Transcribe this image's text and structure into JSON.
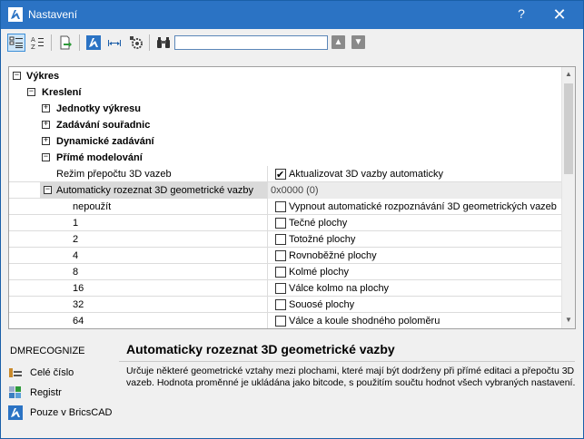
{
  "window": {
    "title": "Nastavení",
    "help": "?",
    "close": "✕"
  },
  "toolbar": {
    "search_value": "",
    "up_label": "▲",
    "down_label": "▼"
  },
  "tree": {
    "cat_vykres": "Výkres",
    "cat_kresleni": "Kreslení",
    "cat_jednotky": "Jednotky výkresu",
    "cat_zadavani": "Zadávání souřadnic",
    "cat_dynamicke": "Dynamické zadávání",
    "cat_prime": "Přímé modelování",
    "prop_rezim": "Režim přepočtu 3D vazeb",
    "prop_rezim_value": "Aktualizovat 3D vazby automaticky",
    "prop_auto": "Automaticky rozeznat 3D geometrické vazby",
    "prop_auto_value": "0x0000 (0)",
    "options": [
      {
        "num": "nepoužít",
        "label": "Vypnout automatické rozpoznávání 3D geometrických vazeb"
      },
      {
        "num": "1",
        "label": "Tečné plochy"
      },
      {
        "num": "2",
        "label": "Totožné plochy"
      },
      {
        "num": "4",
        "label": "Rovnoběžné plochy"
      },
      {
        "num": "8",
        "label": "Kolmé plochy"
      },
      {
        "num": "16",
        "label": "Válce kolmo na plochy"
      },
      {
        "num": "32",
        "label": "Souosé plochy"
      },
      {
        "num": "64",
        "label": "Válce a koule shodného poloměru"
      }
    ]
  },
  "bottom": {
    "command": "DMRECOGNIZE",
    "flag_integer": "Celé číslo",
    "flag_registry": "Registr",
    "flag_bricscad": "Pouze v BricsCAD",
    "desc_title": "Automaticky rozeznat 3D geometrické vazby",
    "desc_text": "Určuje některé geometrické vztahy mezi plochami, které mají být dodrženy při přímé editaci a přepočtu 3D vazeb. Hodnota proměnné je ukládána jako bitcode, s použitím součtu hodnot všech vybraných nastavení."
  }
}
